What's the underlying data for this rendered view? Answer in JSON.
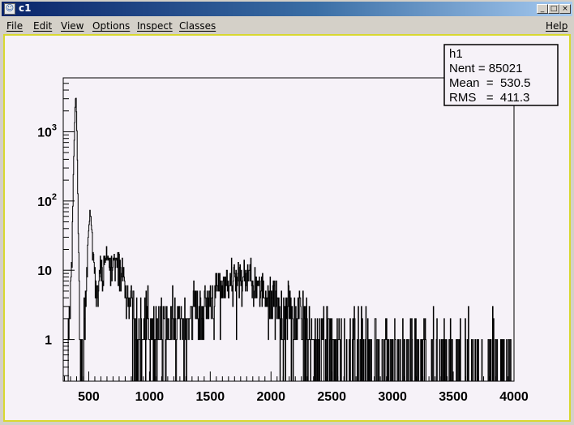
{
  "window": {
    "title": "c1",
    "minimize_label": "_",
    "maximize_label": "□",
    "close_label": "×"
  },
  "menu": {
    "items": [
      "File",
      "Edit",
      "View",
      "Options",
      "Inspect",
      "Classes"
    ],
    "help": "Help"
  },
  "stats_box": {
    "name": "h1",
    "nent": "Nent = 85021",
    "mean": "Mean  =  530.5",
    "rms": "RMS   =  411.3"
  },
  "chart_data": {
    "type": "line",
    "title": "",
    "xlabel": "",
    "ylabel": "",
    "xlim": [
      290,
      4000
    ],
    "ylim": [
      0.25,
      6000
    ],
    "y_scale": "log",
    "grid": false,
    "x_ticks": [
      "500",
      "1000",
      "1500",
      "2000",
      "2500",
      "3000",
      "3500",
      "4000"
    ],
    "y_ticks": [
      {
        "base": "1",
        "exp": ""
      },
      {
        "base": "10",
        "exp": ""
      },
      {
        "base": "10",
        "exp": "2"
      },
      {
        "base": "10",
        "exp": "3"
      }
    ],
    "series": [
      {
        "values_x": [
          290,
          320,
          340,
          360,
          370,
          380,
          385,
          390,
          395,
          400,
          405,
          410,
          420,
          430,
          440,
          450,
          460,
          470,
          480,
          490,
          500,
          510,
          520,
          530,
          540,
          550,
          560,
          570,
          580,
          600,
          620,
          650,
          680,
          700,
          720,
          750,
          780,
          800,
          830,
          860,
          900,
          950,
          1000,
          1050,
          1100,
          1150,
          1200,
          1250,
          1300,
          1350,
          1400,
          1450,
          1500,
          1550,
          1600,
          1650,
          1700,
          1750,
          1800,
          1850,
          1900,
          1950,
          2000,
          2050,
          2100,
          2150,
          2200,
          2250,
          2300,
          2350,
          2400,
          2450,
          2500,
          2550,
          2600,
          2700,
          2800,
          2900,
          3000,
          3100,
          3200,
          3300,
          3400,
          3500,
          3600,
          3700,
          3800,
          3900,
          4000
        ],
        "values_y": [
          0,
          0,
          1,
          10,
          120,
          900,
          2000,
          3300,
          2600,
          1200,
          300,
          40,
          2,
          1,
          1,
          0,
          1,
          2,
          5,
          20,
          45,
          70,
          40,
          20,
          12,
          8,
          7,
          6,
          8,
          10,
          12,
          13,
          14,
          15,
          13,
          12,
          8,
          6,
          4,
          3,
          2,
          2,
          1.5,
          1.5,
          1,
          1.5,
          1.5,
          2,
          2,
          3,
          3,
          3,
          4,
          5,
          6,
          7,
          8,
          8,
          7,
          6,
          5,
          4,
          4,
          3,
          3,
          2.5,
          2,
          2,
          1.5,
          1.5,
          1,
          1,
          1,
          1,
          0.6,
          0.6,
          0.5,
          0.5,
          0.5,
          0.4,
          0.4,
          0.4,
          0.4,
          0.3,
          0.3,
          0.3,
          0.3,
          0.3,
          0.3
        ]
      }
    ]
  }
}
